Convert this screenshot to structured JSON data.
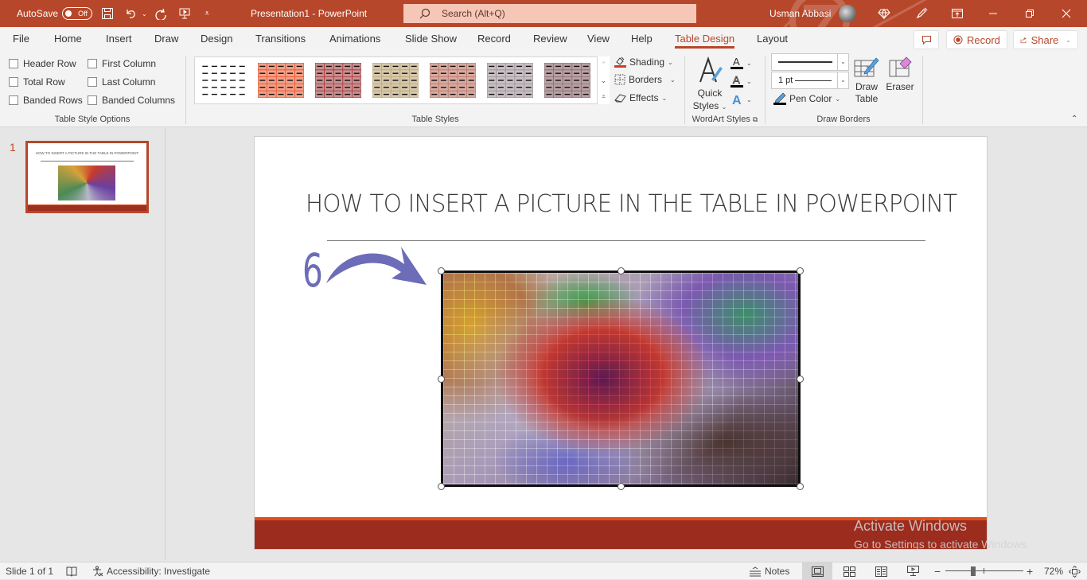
{
  "titlebar": {
    "autosave_label": "AutoSave",
    "autosave_state": "Off",
    "doc_title": "Presentation1  -  PowerPoint",
    "search_placeholder": "Search (Alt+Q)",
    "user_name": "Usman Abbasi",
    "icons": [
      "save-icon",
      "undo-icon",
      "redo-icon",
      "present-from-start-icon",
      "customize-qat-icon",
      "premium-diamond-icon",
      "pen-icon",
      "ribbon-display-icon",
      "minimize-icon",
      "restore-icon",
      "close-icon"
    ]
  },
  "tabs": [
    {
      "label": "File"
    },
    {
      "label": "Home"
    },
    {
      "label": "Insert"
    },
    {
      "label": "Draw"
    },
    {
      "label": "Design"
    },
    {
      "label": "Transitions"
    },
    {
      "label": "Animations"
    },
    {
      "label": "Slide Show"
    },
    {
      "label": "Record"
    },
    {
      "label": "Review"
    },
    {
      "label": "View"
    },
    {
      "label": "Help"
    },
    {
      "label": "Table Design",
      "active": true
    },
    {
      "label": "Layout"
    }
  ],
  "tab_actions": {
    "comments_icon": "comment-icon",
    "record_label": "Record",
    "share_label": "Share"
  },
  "ribbon": {
    "table_style_options": {
      "label": "Table Style Options",
      "checkboxes": [
        {
          "label": "Header Row",
          "checked": false
        },
        {
          "label": "First Column",
          "checked": false
        },
        {
          "label": "Total Row",
          "checked": false
        },
        {
          "label": "Last Column",
          "checked": false
        },
        {
          "label": "Banded Rows",
          "checked": false
        },
        {
          "label": "Banded Columns",
          "checked": false
        }
      ]
    },
    "table_styles": {
      "label": "Table Styles",
      "styles": [
        {
          "name": "No Style, Table Grid",
          "fill": "#ffffff",
          "line": "#ffffff"
        },
        {
          "name": "Medium Style 2 - Accent 1",
          "fill": "#f2a088",
          "line": "#e8502a"
        },
        {
          "name": "Medium Style 2 - Accent 2",
          "fill": "#c99090",
          "line": "#a8343a"
        },
        {
          "name": "Medium Style 2 - Accent 3",
          "fill": "#d8c8aa",
          "line": "#b8a57a"
        },
        {
          "name": "Medium Style 2 - Accent 4",
          "fill": "#d8aaa0",
          "line": "#b8766a"
        },
        {
          "name": "Medium Style 2 - Accent 5",
          "fill": "#c8c0c4",
          "line": "#9a9096"
        },
        {
          "name": "Medium Style 2 - Accent 6",
          "fill": "#b8a0a4",
          "line": "#8a6a70"
        }
      ],
      "shading_label": "Shading",
      "borders_label": "Borders",
      "effects_label": "Effects"
    },
    "wordart_styles": {
      "label": "WordArt Styles",
      "quick_styles_label_1": "Quick",
      "quick_styles_label_2": "Styles",
      "text_fill_icon": "text-fill-icon",
      "text_outline_icon": "text-outline-icon",
      "text_effects_icon": "text-effects-icon"
    },
    "draw_borders": {
      "label": "Draw Borders",
      "pen_style_value": "solid line",
      "pen_weight_value": "1 pt",
      "pen_color_label": "Pen Color",
      "draw_table_label_1": "Draw",
      "draw_table_label_2": "Table",
      "eraser_label": "Eraser"
    }
  },
  "thumbnails": [
    {
      "number": "1",
      "title": "HOW TO INSERT A PICTURE IN THE TABLE IN POWERPOINT"
    }
  ],
  "slide": {
    "title": "HOW TO INSERT A PICTURE IN THE TABLE IN POWERPOINT",
    "step_number": "6",
    "picture_description": "colorful paper mosaic collage in a table cell"
  },
  "watermark": {
    "line1": "Activate Windows",
    "line2": "Go to Settings to activate Windows."
  },
  "statusbar": {
    "slide_info": "Slide 1 of 1",
    "accessibility": "Accessibility: Investigate",
    "notes_label": "Notes",
    "zoom_level": "72%",
    "zoom_fraction": 0.36
  },
  "colors": {
    "accent": "#b7472a",
    "slide_bar": "#9b2c1e",
    "slide_bar_top": "#e04e1b",
    "arrow": "#6c6cb8"
  }
}
